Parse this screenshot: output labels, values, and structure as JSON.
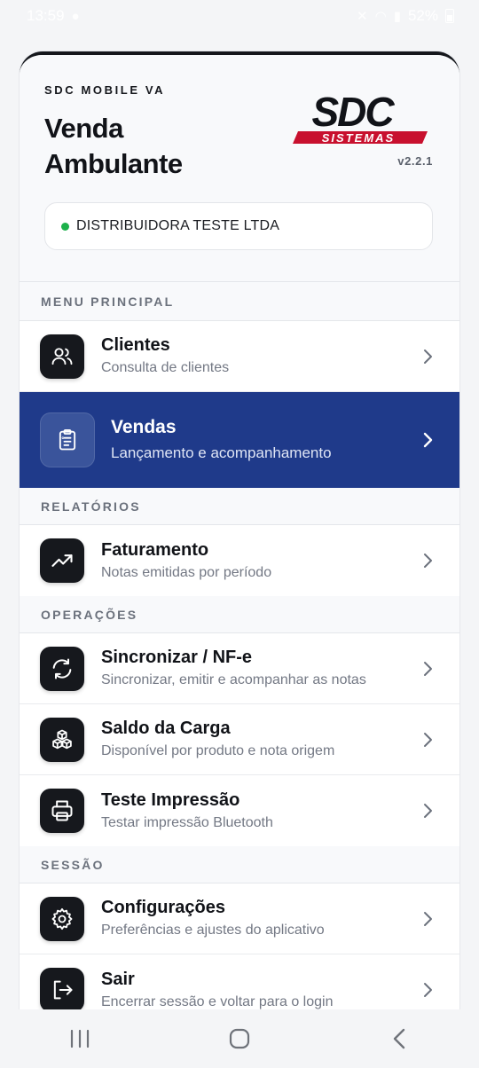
{
  "status_bar": {
    "time": "13:59",
    "battery": "52%"
  },
  "header": {
    "subtitle": "SDC MOBILE VA",
    "title": "Venda Ambulante",
    "version": "v2.2.1",
    "logo_text": "SDC",
    "logo_subtext": "SISTEMAS",
    "company": "DISTRIBUIDORA TESTE LTDA"
  },
  "sections": {
    "main": "MENU PRINCIPAL",
    "reports": "RELATÓRIOS",
    "operations": "OPERAÇÕES",
    "session": "SESSÃO"
  },
  "items": {
    "clientes": {
      "title": "Clientes",
      "desc": "Consulta de clientes",
      "icon": "users-icon"
    },
    "vendas": {
      "title": "Vendas",
      "desc": "Lançamento e acompanhamento",
      "icon": "clipboard-icon"
    },
    "faturamento": {
      "title": "Faturamento",
      "desc": "Notas emitidas por período",
      "icon": "trending-up-icon"
    },
    "sincronizar": {
      "title": "Sincronizar / NF-e",
      "desc": "Sincronizar, emitir e acompanhar as notas",
      "icon": "refresh-icon"
    },
    "saldo": {
      "title": "Saldo da Carga",
      "desc": "Disponível por produto e nota origem",
      "icon": "boxes-icon"
    },
    "impressao": {
      "title": "Teste Impressão",
      "desc": "Testar impressão Bluetooth",
      "icon": "printer-icon"
    },
    "config": {
      "title": "Configurações",
      "desc": "Preferências e ajustes do aplicativo",
      "icon": "gear-icon"
    },
    "sair": {
      "title": "Sair",
      "desc": "Encerrar sessão e voltar para o login",
      "icon": "logout-icon"
    }
  },
  "colors": {
    "accent": "#1f3a8a",
    "icon_bg": "#16181d",
    "online": "#1db14b",
    "logo_red": "#c8102e"
  }
}
